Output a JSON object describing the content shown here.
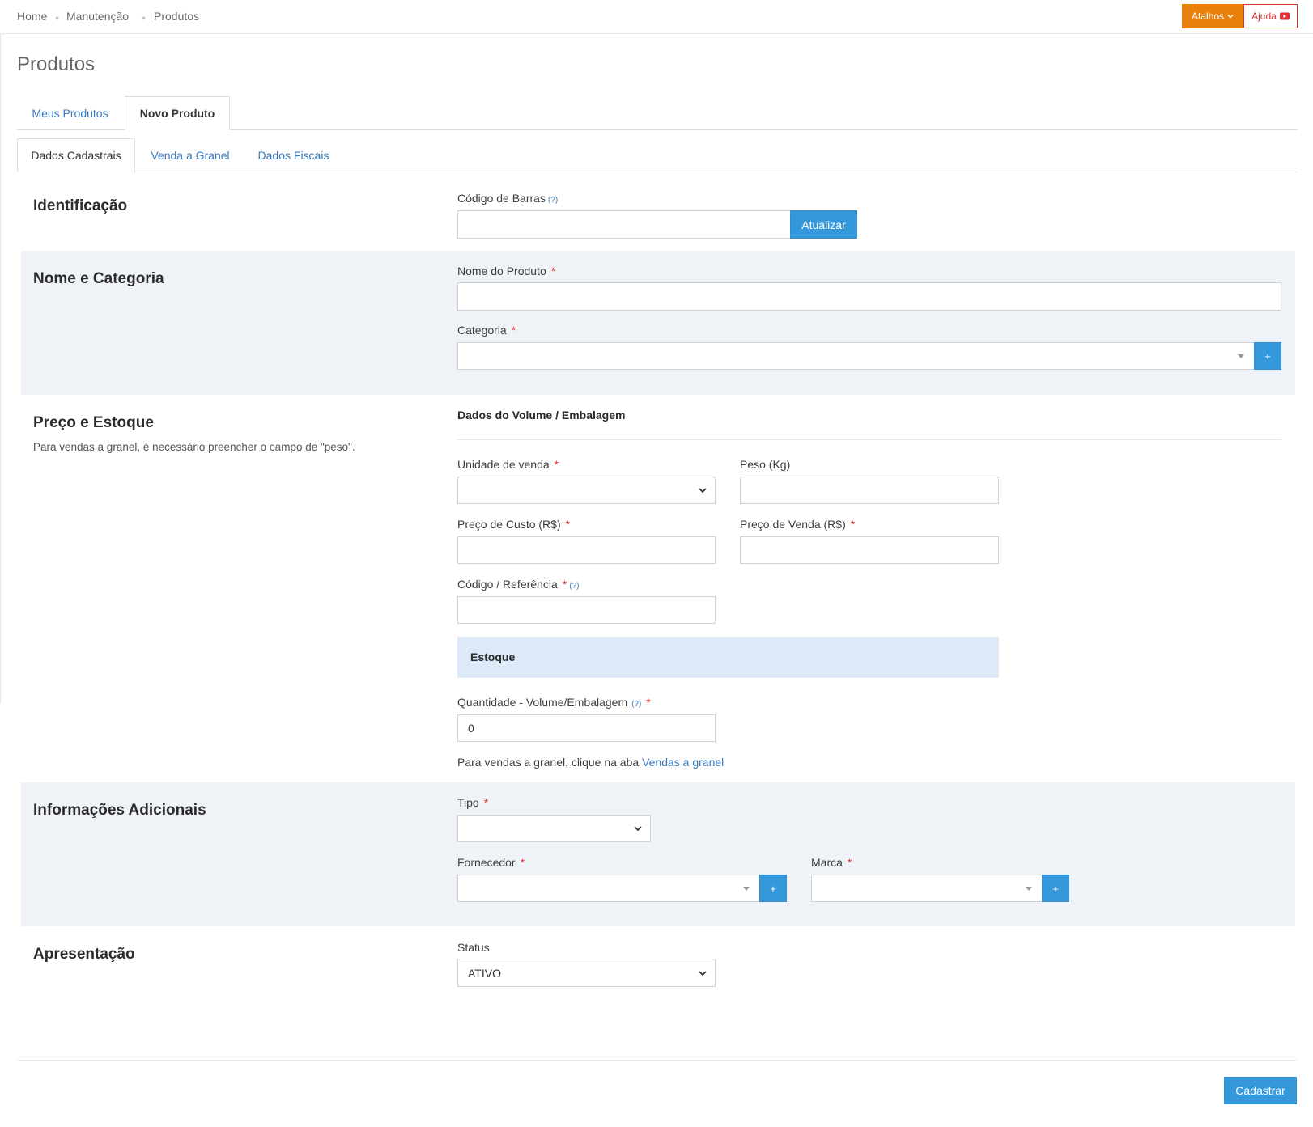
{
  "breadcrumb": [
    "Home",
    "Manutenção",
    "Produtos"
  ],
  "topbar": {
    "atalhos_label": "Atalhos",
    "ajuda_label": "Ajuda",
    "atalhos_color": "#e8810b",
    "ajuda_color": "#e03030"
  },
  "page_title": "Produtos",
  "main_tabs": [
    {
      "label": "Meus Produtos"
    },
    {
      "label": "Novo Produto",
      "active": true
    }
  ],
  "sub_tabs": [
    {
      "label": "Dados Cadastrais",
      "active": true
    },
    {
      "label": "Venda a Granel"
    },
    {
      "label": "Dados Fiscais"
    }
  ],
  "identificacao": {
    "title": "Identificação",
    "barcode_label": "Código de Barras",
    "help_mark": "(?)",
    "barcode_value": "",
    "update_button": "Atualizar"
  },
  "nome_categoria": {
    "title": "Nome e Categoria",
    "nome_label": "Nome do Produto",
    "nome_value": "",
    "categoria_label": "Categoria",
    "categoria_value": "",
    "add_button": "+"
  },
  "preco_estoque": {
    "title": "Preço e Estoque",
    "description": "Para vendas a granel, é necessário preencher o campo de \"peso\".",
    "volume_heading": "Dados do Volume / Embalagem",
    "unidade_label": "Unidade de venda",
    "unidade_value": "",
    "peso_label": "Peso (Kg)",
    "peso_value": "",
    "custo_label": "Preço de Custo (R$)",
    "custo_value": "",
    "venda_label": "Preço de Venda (R$)",
    "venda_value": "",
    "codigo_label": "Código / Referência",
    "codigo_value": "",
    "estoque_heading": "Estoque",
    "quantidade_label": "Quantidade - Volume/Embalagem",
    "quantidade_value": "0",
    "granel_note": "Para vendas a granel, clique na aba",
    "granel_link": "Vendas a granel"
  },
  "info_adicionais": {
    "title": "Informações Adicionais",
    "tipo_label": "Tipo",
    "tipo_value": "",
    "fornecedor_label": "Fornecedor",
    "fornecedor_value": "",
    "marca_label": "Marca",
    "marca_value": "",
    "add_button": "+"
  },
  "apresentacao": {
    "title": "Apresentação",
    "status_label": "Status",
    "status_value": "ATIVO"
  },
  "required_mark": "*",
  "footer": {
    "submit_label": "Cadastrar"
  },
  "colors": {
    "accent": "#3498db",
    "band": "#eff2f6",
    "estoque": "#dde9f7",
    "link": "#3a7bbf",
    "required": "#e03030"
  },
  "icons": [
    "chevron-down-icon",
    "youtube-icon",
    "select-arrow-icon",
    "caret-down-icon"
  ]
}
